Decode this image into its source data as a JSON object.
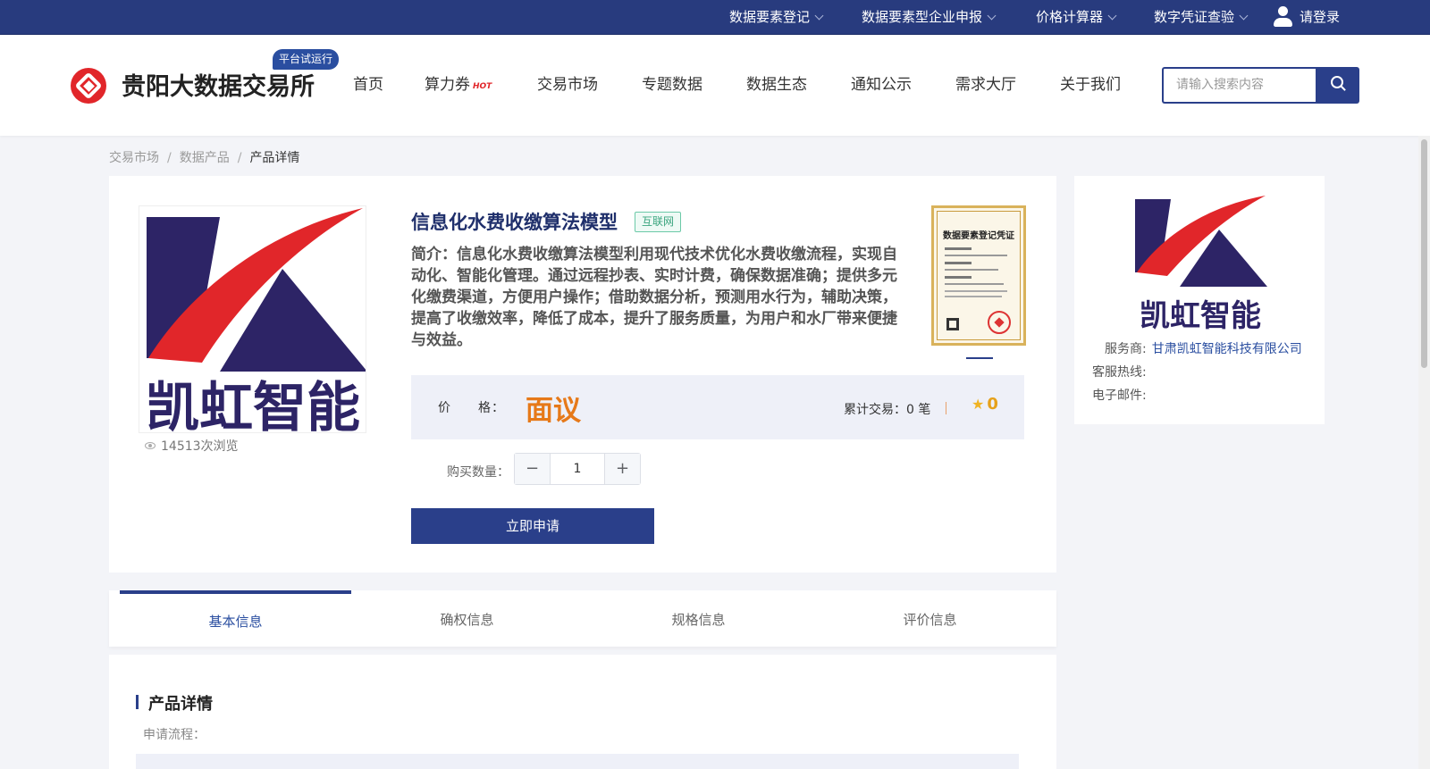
{
  "topbar": {
    "items": [
      {
        "label": "数据要素登记"
      },
      {
        "label": "数据要素型企业申报"
      },
      {
        "label": "价格计算器"
      },
      {
        "label": "数字凭证查验"
      }
    ],
    "login_label": "请登录"
  },
  "header": {
    "site_title": "贵阳大数据交易所",
    "trial_badge": "平台试运行",
    "nav": [
      {
        "label": "首页"
      },
      {
        "label": "算力券",
        "badge": "HOT"
      },
      {
        "label": "交易市场"
      },
      {
        "label": "专题数据"
      },
      {
        "label": "数据生态"
      },
      {
        "label": "通知公示"
      },
      {
        "label": "需求大厅"
      },
      {
        "label": "关于我们"
      }
    ],
    "search_placeholder": "请输入搜索内容"
  },
  "breadcrumb": {
    "items": [
      "交易市场",
      "数据产品",
      "产品详情"
    ]
  },
  "product": {
    "image_text": "凯虹智能",
    "views": "14513次浏览",
    "title": "信息化水费收缴算法模型",
    "tag": "互联网",
    "intro": "简介：信息化水费收缴算法模型利用现代技术优化水费收缴流程，实现自动化、智能化管理。通过远程抄表、实时计费，确保数据准确；提供多元化缴费渠道，方便用户操作；借助数据分析，预测用水行为，辅助决策，提高了收缴效率，降低了成本，提升了服务质量，为用户和水厂带来便捷与效益。",
    "cert_title": "数据要素登记凭证",
    "price_label": "价　　格：",
    "price_value": "面议",
    "traded": "累计交易：0 笔",
    "rating": "0",
    "qty_label": "购买数量：",
    "qty_value": "1",
    "minus": "−",
    "plus": "+",
    "apply_label": "立即申请"
  },
  "provider": {
    "logo_text": "凯虹智能",
    "service_label": "服务商:",
    "service_name": "甘肃凯虹智能科技有限公司",
    "hotline_label": "客服热线:",
    "email_label": "电子邮件:"
  },
  "tabs": [
    {
      "label": "基本信息"
    },
    {
      "label": "确权信息"
    },
    {
      "label": "规格信息"
    },
    {
      "label": "评价信息"
    }
  ],
  "detail": {
    "title": "产品详情",
    "flow_label": "申请流程："
  },
  "colors": {
    "primary": "#2a3f8a",
    "topbar": "#283b7e",
    "accent_red": "#e1262a",
    "price_orange": "#e67919",
    "logo_navy": "#2d2466"
  }
}
